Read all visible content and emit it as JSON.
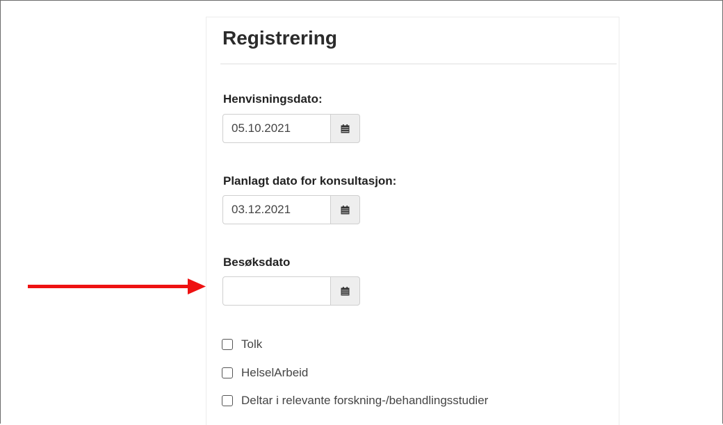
{
  "panel": {
    "title": "Registrering"
  },
  "fields": {
    "henvisningsdato": {
      "label": "Henvisningsdato:",
      "value": "05.10.2021"
    },
    "planlagt": {
      "label": "Planlagt dato for konsultasjon:",
      "value": "03.12.2021"
    },
    "besoksdato": {
      "label": "Besøksdato",
      "value": ""
    }
  },
  "checkboxes": [
    {
      "label": "Tolk",
      "checked": false
    },
    {
      "label": "HelselArbeid",
      "checked": false
    },
    {
      "label": "Deltar i relevante forskning-/behandlingsstudier",
      "checked": false
    }
  ],
  "icons": {
    "date_button": "calendar-icon",
    "annotation": "red-arrow-icon"
  },
  "colors": {
    "arrow": "#ee1111",
    "button_bg": "#eeeeee",
    "border": "#cfcfcf"
  }
}
